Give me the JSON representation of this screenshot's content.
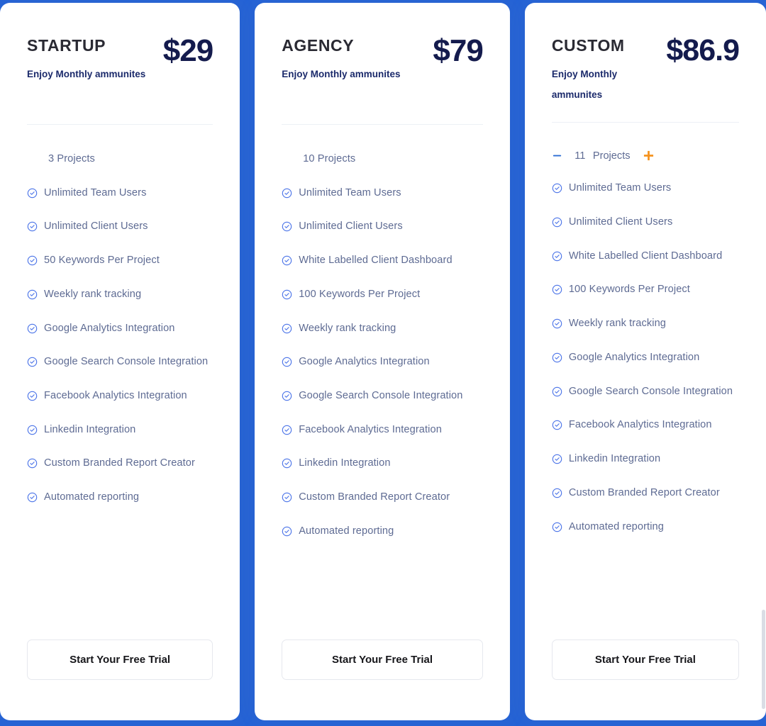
{
  "theme": {
    "page_background": "#2563d6",
    "card_background": "#ffffff",
    "price_color": "#141b4d",
    "plan_name_color": "#2a2a33",
    "feature_text_color": "#5e6b93",
    "check_icon_color": "#4a73e8",
    "minus_color": "#2b6cd4",
    "plus_color": "#f5921e",
    "cta_text_color": "#16161a",
    "divider_color": "#edf0f5"
  },
  "plans": [
    {
      "name": "STARTUP",
      "subtitle": "Enjoy Monthly ammunites",
      "price": "$29",
      "projects_label": "3 Projects",
      "has_stepper": false,
      "features": [
        "Unlimited Team Users",
        "Unlimited Client Users",
        "50 Keywords Per Project",
        "Weekly rank tracking",
        "Google Analytics Integration",
        "Google Search Console Integration",
        "Facebook Analytics Integration",
        "Linkedin Integration",
        "Custom Branded Report Creator",
        "Automated reporting"
      ],
      "cta_label": "Start Your Free Trial"
    },
    {
      "name": "AGENCY",
      "subtitle": "Enjoy Monthly ammunites",
      "price": "$79",
      "projects_label": "10 Projects",
      "has_stepper": false,
      "features": [
        "Unlimited Team Users",
        "Unlimited Client Users",
        "White Labelled Client Dashboard",
        "100 Keywords Per Project",
        "Weekly rank tracking",
        "Google Analytics Integration",
        "Google Search Console Integration",
        "Facebook Analytics Integration",
        "Linkedin Integration",
        "Custom Branded Report Creator",
        "Automated reporting"
      ],
      "cta_label": "Start Your Free Trial"
    },
    {
      "name": "CUSTOM",
      "subtitle": "Enjoy Monthly ammunites",
      "price": "$86.9",
      "projects_label": "Projects",
      "has_stepper": true,
      "stepper": {
        "decrease_icon": "minus-icon",
        "increase_icon": "plus-icon",
        "value": "11",
        "label": "Projects"
      },
      "features": [
        "Unlimited Team Users",
        "Unlimited Client Users",
        "White Labelled Client Dashboard",
        "100 Keywords Per Project",
        "Weekly rank tracking",
        "Google Analytics Integration",
        "Google Search Console Integration",
        "Facebook Analytics Integration",
        "Linkedin Integration",
        "Custom Branded Report Creator",
        "Automated reporting"
      ],
      "cta_label": "Start Your Free Trial"
    }
  ],
  "icons": {
    "check": "check-circle-icon",
    "minus": "minus-icon",
    "plus": "plus-icon"
  }
}
